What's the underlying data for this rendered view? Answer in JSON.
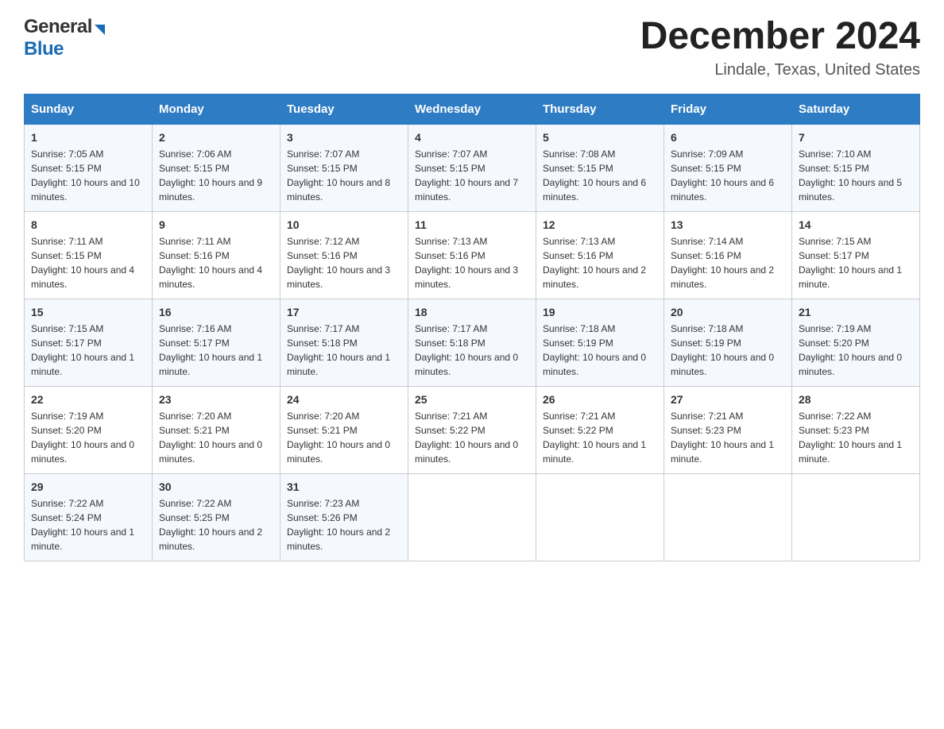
{
  "header": {
    "logo_text1": "General",
    "logo_text2": "Blue",
    "title": "December 2024",
    "subtitle": "Lindale, Texas, United States"
  },
  "days_of_week": [
    "Sunday",
    "Monday",
    "Tuesday",
    "Wednesday",
    "Thursday",
    "Friday",
    "Saturday"
  ],
  "weeks": [
    [
      {
        "day": "1",
        "sunrise": "Sunrise: 7:05 AM",
        "sunset": "Sunset: 5:15 PM",
        "daylight": "Daylight: 10 hours and 10 minutes."
      },
      {
        "day": "2",
        "sunrise": "Sunrise: 7:06 AM",
        "sunset": "Sunset: 5:15 PM",
        "daylight": "Daylight: 10 hours and 9 minutes."
      },
      {
        "day": "3",
        "sunrise": "Sunrise: 7:07 AM",
        "sunset": "Sunset: 5:15 PM",
        "daylight": "Daylight: 10 hours and 8 minutes."
      },
      {
        "day": "4",
        "sunrise": "Sunrise: 7:07 AM",
        "sunset": "Sunset: 5:15 PM",
        "daylight": "Daylight: 10 hours and 7 minutes."
      },
      {
        "day": "5",
        "sunrise": "Sunrise: 7:08 AM",
        "sunset": "Sunset: 5:15 PM",
        "daylight": "Daylight: 10 hours and 6 minutes."
      },
      {
        "day": "6",
        "sunrise": "Sunrise: 7:09 AM",
        "sunset": "Sunset: 5:15 PM",
        "daylight": "Daylight: 10 hours and 6 minutes."
      },
      {
        "day": "7",
        "sunrise": "Sunrise: 7:10 AM",
        "sunset": "Sunset: 5:15 PM",
        "daylight": "Daylight: 10 hours and 5 minutes."
      }
    ],
    [
      {
        "day": "8",
        "sunrise": "Sunrise: 7:11 AM",
        "sunset": "Sunset: 5:15 PM",
        "daylight": "Daylight: 10 hours and 4 minutes."
      },
      {
        "day": "9",
        "sunrise": "Sunrise: 7:11 AM",
        "sunset": "Sunset: 5:16 PM",
        "daylight": "Daylight: 10 hours and 4 minutes."
      },
      {
        "day": "10",
        "sunrise": "Sunrise: 7:12 AM",
        "sunset": "Sunset: 5:16 PM",
        "daylight": "Daylight: 10 hours and 3 minutes."
      },
      {
        "day": "11",
        "sunrise": "Sunrise: 7:13 AM",
        "sunset": "Sunset: 5:16 PM",
        "daylight": "Daylight: 10 hours and 3 minutes."
      },
      {
        "day": "12",
        "sunrise": "Sunrise: 7:13 AM",
        "sunset": "Sunset: 5:16 PM",
        "daylight": "Daylight: 10 hours and 2 minutes."
      },
      {
        "day": "13",
        "sunrise": "Sunrise: 7:14 AM",
        "sunset": "Sunset: 5:16 PM",
        "daylight": "Daylight: 10 hours and 2 minutes."
      },
      {
        "day": "14",
        "sunrise": "Sunrise: 7:15 AM",
        "sunset": "Sunset: 5:17 PM",
        "daylight": "Daylight: 10 hours and 1 minute."
      }
    ],
    [
      {
        "day": "15",
        "sunrise": "Sunrise: 7:15 AM",
        "sunset": "Sunset: 5:17 PM",
        "daylight": "Daylight: 10 hours and 1 minute."
      },
      {
        "day": "16",
        "sunrise": "Sunrise: 7:16 AM",
        "sunset": "Sunset: 5:17 PM",
        "daylight": "Daylight: 10 hours and 1 minute."
      },
      {
        "day": "17",
        "sunrise": "Sunrise: 7:17 AM",
        "sunset": "Sunset: 5:18 PM",
        "daylight": "Daylight: 10 hours and 1 minute."
      },
      {
        "day": "18",
        "sunrise": "Sunrise: 7:17 AM",
        "sunset": "Sunset: 5:18 PM",
        "daylight": "Daylight: 10 hours and 0 minutes."
      },
      {
        "day": "19",
        "sunrise": "Sunrise: 7:18 AM",
        "sunset": "Sunset: 5:19 PM",
        "daylight": "Daylight: 10 hours and 0 minutes."
      },
      {
        "day": "20",
        "sunrise": "Sunrise: 7:18 AM",
        "sunset": "Sunset: 5:19 PM",
        "daylight": "Daylight: 10 hours and 0 minutes."
      },
      {
        "day": "21",
        "sunrise": "Sunrise: 7:19 AM",
        "sunset": "Sunset: 5:20 PM",
        "daylight": "Daylight: 10 hours and 0 minutes."
      }
    ],
    [
      {
        "day": "22",
        "sunrise": "Sunrise: 7:19 AM",
        "sunset": "Sunset: 5:20 PM",
        "daylight": "Daylight: 10 hours and 0 minutes."
      },
      {
        "day": "23",
        "sunrise": "Sunrise: 7:20 AM",
        "sunset": "Sunset: 5:21 PM",
        "daylight": "Daylight: 10 hours and 0 minutes."
      },
      {
        "day": "24",
        "sunrise": "Sunrise: 7:20 AM",
        "sunset": "Sunset: 5:21 PM",
        "daylight": "Daylight: 10 hours and 0 minutes."
      },
      {
        "day": "25",
        "sunrise": "Sunrise: 7:21 AM",
        "sunset": "Sunset: 5:22 PM",
        "daylight": "Daylight: 10 hours and 0 minutes."
      },
      {
        "day": "26",
        "sunrise": "Sunrise: 7:21 AM",
        "sunset": "Sunset: 5:22 PM",
        "daylight": "Daylight: 10 hours and 1 minute."
      },
      {
        "day": "27",
        "sunrise": "Sunrise: 7:21 AM",
        "sunset": "Sunset: 5:23 PM",
        "daylight": "Daylight: 10 hours and 1 minute."
      },
      {
        "day": "28",
        "sunrise": "Sunrise: 7:22 AM",
        "sunset": "Sunset: 5:23 PM",
        "daylight": "Daylight: 10 hours and 1 minute."
      }
    ],
    [
      {
        "day": "29",
        "sunrise": "Sunrise: 7:22 AM",
        "sunset": "Sunset: 5:24 PM",
        "daylight": "Daylight: 10 hours and 1 minute."
      },
      {
        "day": "30",
        "sunrise": "Sunrise: 7:22 AM",
        "sunset": "Sunset: 5:25 PM",
        "daylight": "Daylight: 10 hours and 2 minutes."
      },
      {
        "day": "31",
        "sunrise": "Sunrise: 7:23 AM",
        "sunset": "Sunset: 5:26 PM",
        "daylight": "Daylight: 10 hours and 2 minutes."
      },
      {
        "day": "",
        "sunrise": "",
        "sunset": "",
        "daylight": ""
      },
      {
        "day": "",
        "sunrise": "",
        "sunset": "",
        "daylight": ""
      },
      {
        "day": "",
        "sunrise": "",
        "sunset": "",
        "daylight": ""
      },
      {
        "day": "",
        "sunrise": "",
        "sunset": "",
        "daylight": ""
      }
    ]
  ]
}
